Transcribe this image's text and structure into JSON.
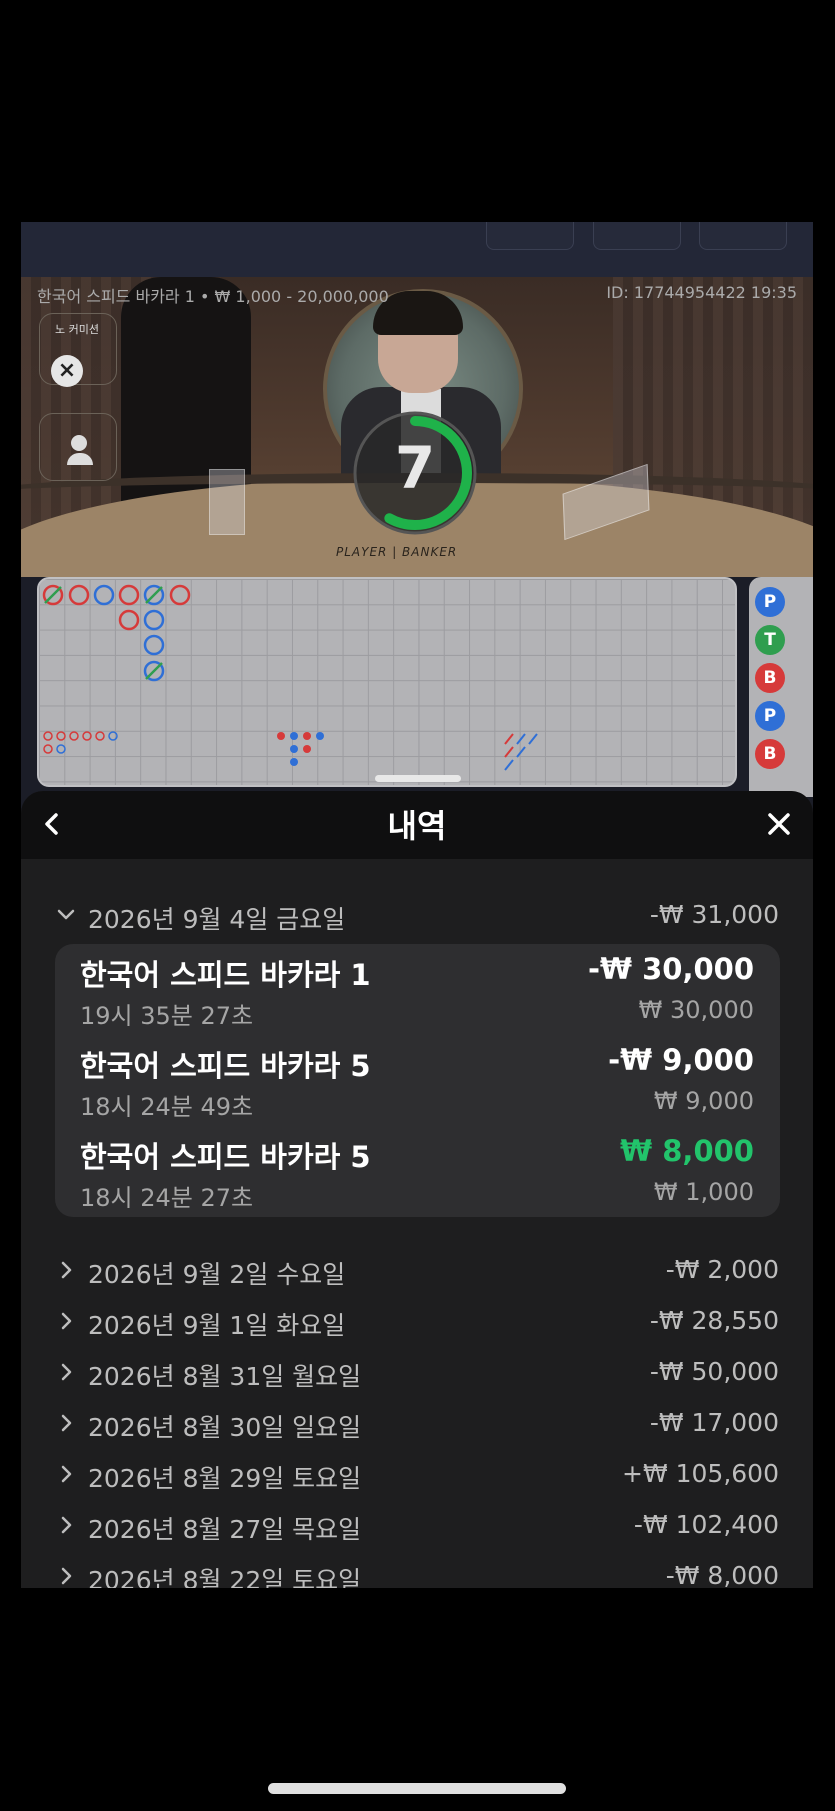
{
  "game": {
    "table_info": "한국어 스피드 바카라 1 • ₩ 1,000 - 20,000,000",
    "round_id": "ID: 17744954422 19:35",
    "no_commission": "노 커미션",
    "timer_value": "7",
    "table_text": "PLAYER | BANKER",
    "bead_road": [
      "P",
      "T",
      "B",
      "P",
      "B"
    ],
    "colors": {
      "player": "#2f6fd6",
      "banker": "#d63a3a",
      "tie": "#2f9e4f",
      "timer": "#1fb24a"
    }
  },
  "sheet": {
    "title": "내역",
    "expanded_day": {
      "date": "2026년 9월 4일 금요일",
      "total": "-₩ 31,000",
      "bets": [
        {
          "name": "한국어 스피드 바카라 1",
          "time": "19시 35분 27초",
          "result": "-₩ 30,000",
          "stake": "₩ 30,000",
          "win": false
        },
        {
          "name": "한국어 스피드 바카라 5",
          "time": "18시 24분 49초",
          "result": "-₩ 9,000",
          "stake": "₩ 9,000",
          "win": false
        },
        {
          "name": "한국어 스피드 바카라 5",
          "time": "18시 24분 27초",
          "result": "₩ 8,000",
          "stake": "₩ 1,000",
          "win": true
        }
      ]
    },
    "days": [
      {
        "date": "2026년 9월 2일 수요일",
        "total": "-₩ 2,000"
      },
      {
        "date": "2026년 9월 1일 화요일",
        "total": "-₩ 28,550"
      },
      {
        "date": "2026년 8월 31일 월요일",
        "total": "-₩ 50,000"
      },
      {
        "date": "2026년 8월 30일 일요일",
        "total": "-₩ 17,000"
      },
      {
        "date": "2026년 8월 29일 토요일",
        "total": "+₩ 105,600"
      },
      {
        "date": "2026년 8월 27일 목요일",
        "total": "-₩ 102,400"
      },
      {
        "date": "2026년 8월 22일 토요일",
        "total": "-₩ 8,000"
      }
    ],
    "win_color": "#22c46b"
  },
  "icons": {
    "back": "chevron-left-icon",
    "close": "close-icon",
    "expanded": "chevron-down-icon",
    "collapsed": "chevron-right-icon"
  }
}
